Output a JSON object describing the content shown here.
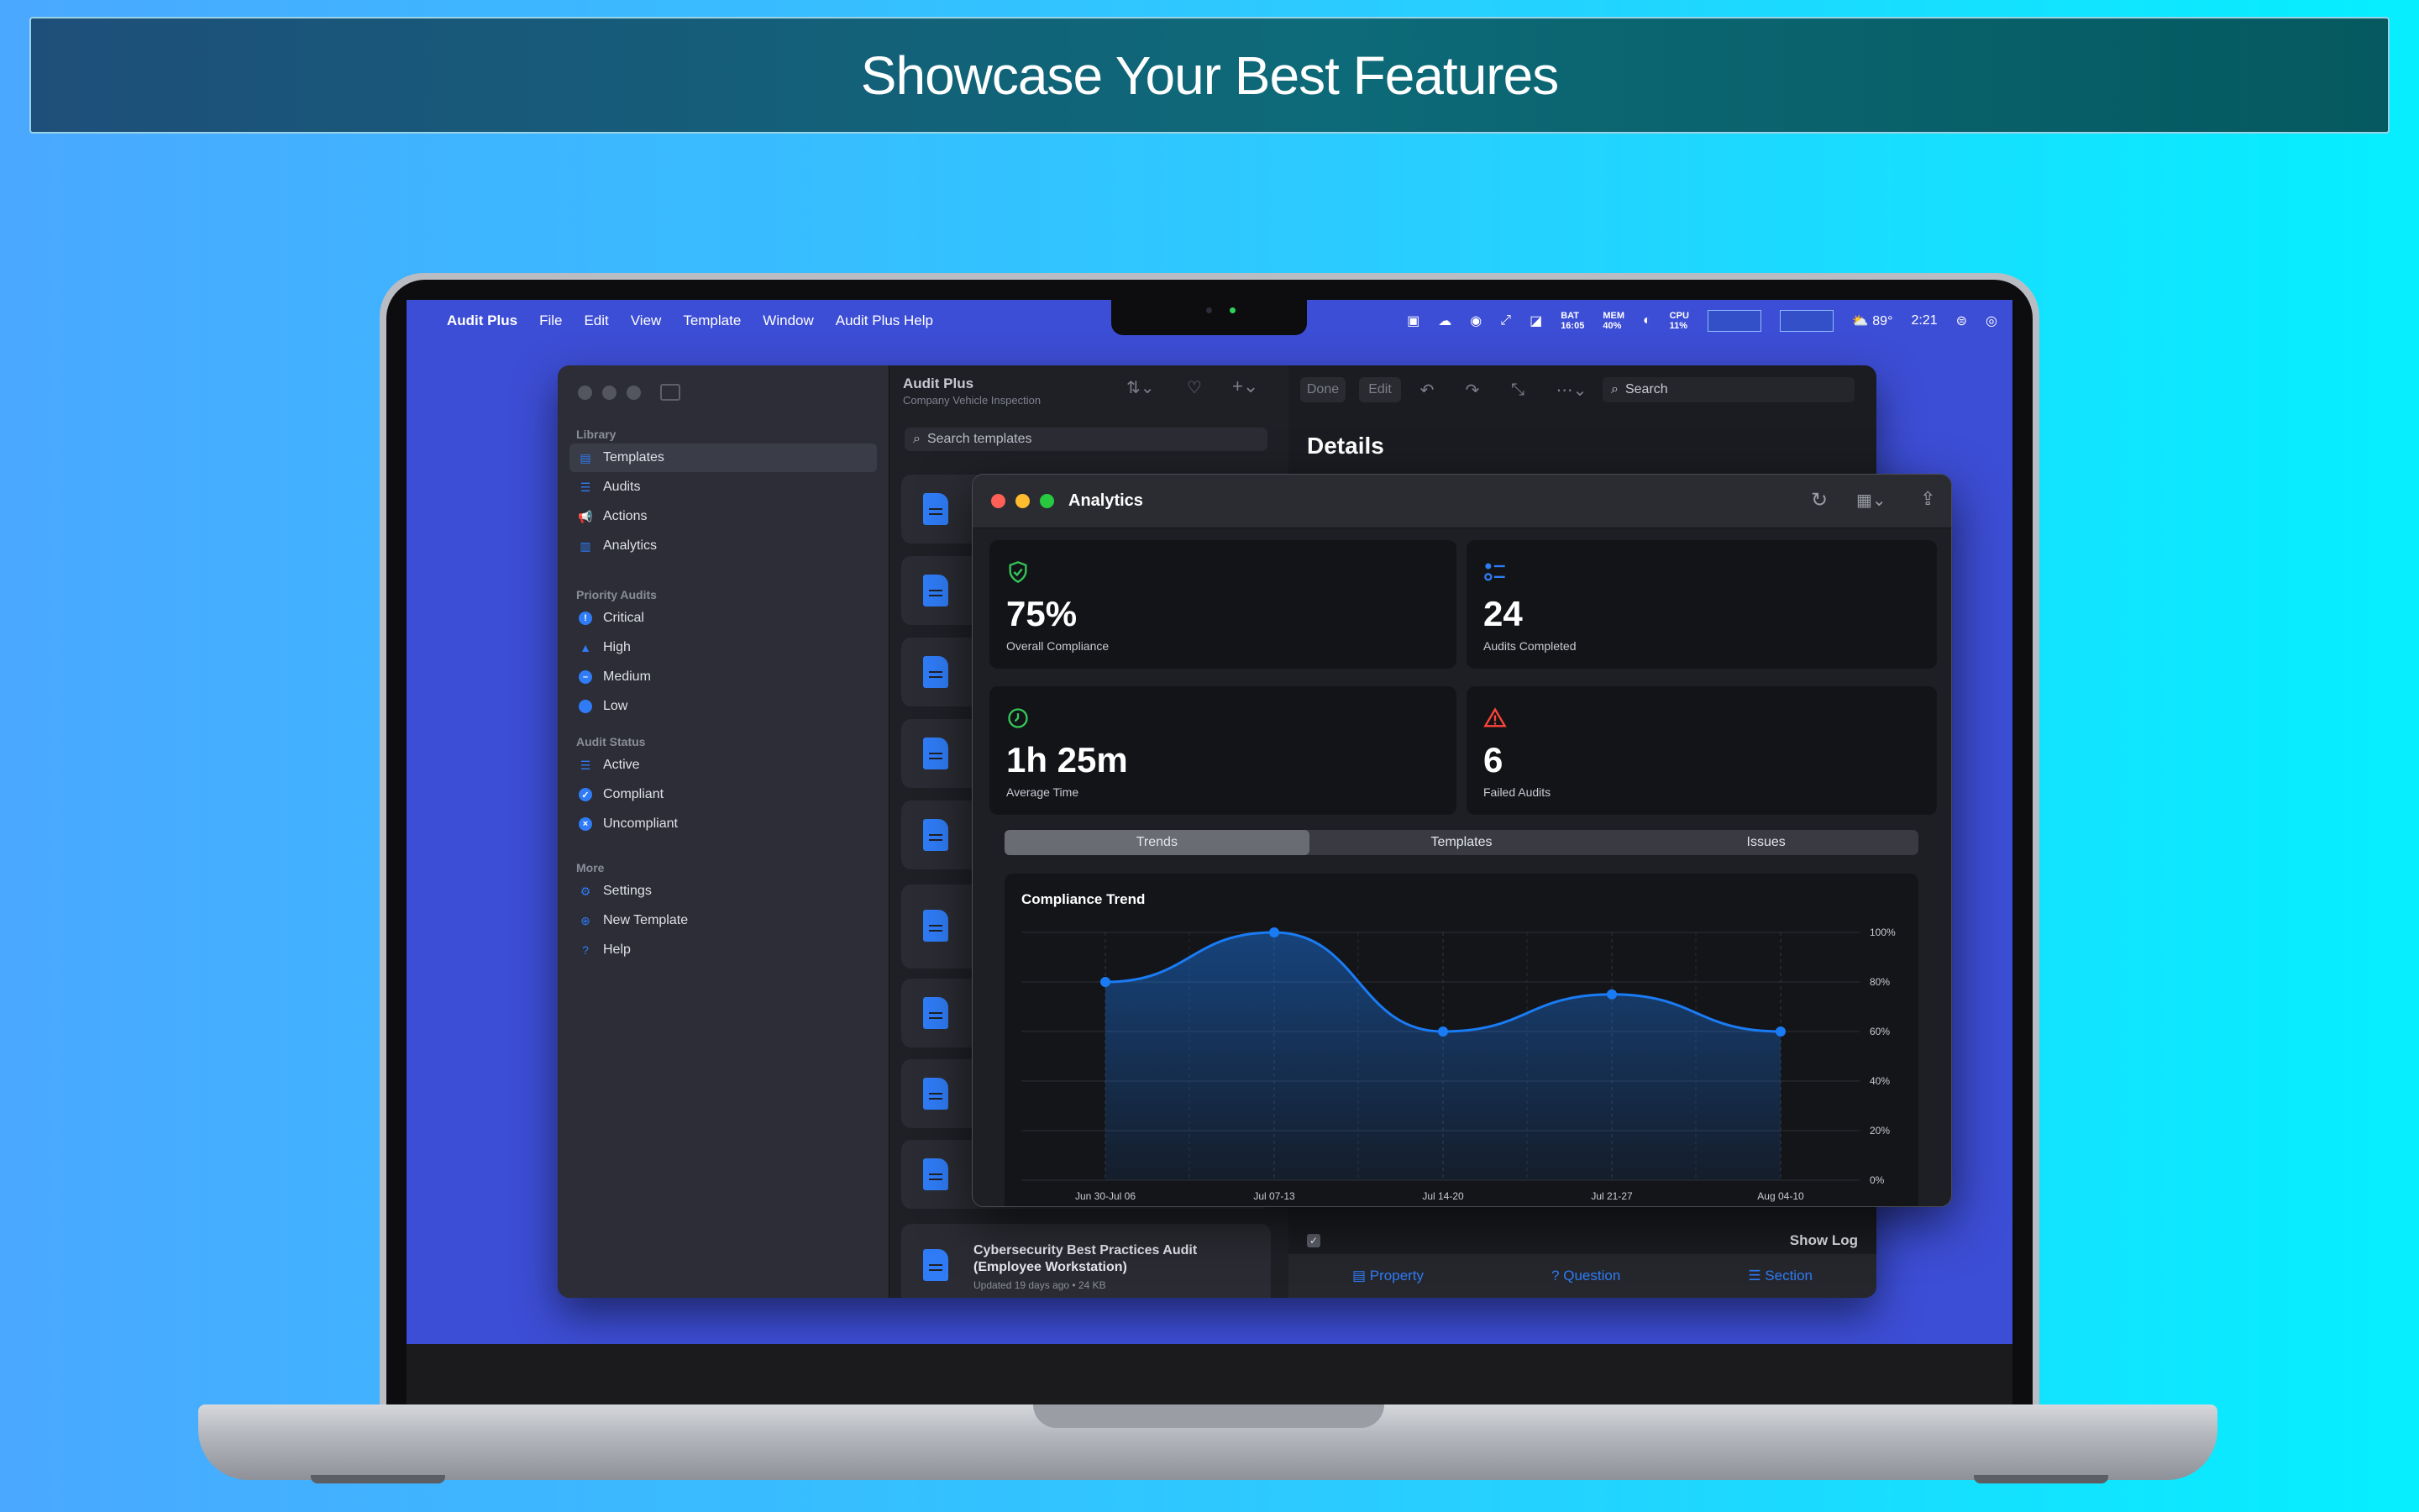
{
  "banner": {
    "title": "Showcase Your Best Features"
  },
  "menubar": {
    "app": "Audit Plus",
    "items": [
      "File",
      "Edit",
      "View",
      "Template",
      "Window",
      "Audit Plus Help"
    ],
    "bat_label": "BAT",
    "bat_value": "16:05",
    "mem_label": "MEM",
    "mem_value": "40%",
    "cpu_label": "CPU",
    "cpu_value": "11%",
    "weather": "89°",
    "time": "2:21"
  },
  "sidebar": {
    "library_title": "Library",
    "library": [
      {
        "label": "Templates",
        "icon": "doc-icon"
      },
      {
        "label": "Audits",
        "icon": "checklist-icon"
      },
      {
        "label": "Actions",
        "icon": "megaphone-icon"
      },
      {
        "label": "Analytics",
        "icon": "bar-chart-icon"
      }
    ],
    "priority_title": "Priority Audits",
    "priority": [
      {
        "label": "Critical",
        "icon": "exclamation-circle-icon"
      },
      {
        "label": "High",
        "icon": "warning-triangle-icon"
      },
      {
        "label": "Medium",
        "icon": "minus-circle-icon"
      },
      {
        "label": "Low",
        "icon": "circle-icon"
      }
    ],
    "status_title": "Audit Status",
    "status": [
      {
        "label": "Active",
        "icon": "checklist-icon"
      },
      {
        "label": "Compliant",
        "icon": "check-circle-icon"
      },
      {
        "label": "Uncompliant",
        "icon": "x-circle-icon"
      }
    ],
    "more_title": "More",
    "more": [
      {
        "label": "Settings",
        "icon": "gear-icon"
      },
      {
        "label": "New Template",
        "icon": "plus-circle-icon"
      },
      {
        "label": "Help",
        "icon": "question-circle-icon"
      }
    ]
  },
  "list": {
    "title": "Audit Plus",
    "subtitle": "Company Vehicle Inspection",
    "search_placeholder": "Search templates",
    "last_card_title": "Cybersecurity Best Practices Audit (Employee Workstation)",
    "last_card_meta": "Updated 19 days ago • 24 KB"
  },
  "detail": {
    "done": "Done",
    "edit": "Edit",
    "search": "Search",
    "title": "Details",
    "show_log": "Show Log",
    "bottom": [
      "Property",
      "Question",
      "Section"
    ]
  },
  "analytics": {
    "title": "Analytics",
    "tiles": [
      {
        "value": "75%",
        "label": "Overall Compliance",
        "icon": "shield-check-icon",
        "color": "#34c759"
      },
      {
        "value": "24",
        "label": "Audits Completed",
        "icon": "checklist-icon",
        "color": "#2f7cf6"
      },
      {
        "value": "1h 25m",
        "label": "Average Time",
        "icon": "clock-icon",
        "color": "#34c759"
      },
      {
        "value": "6",
        "label": "Failed Audits",
        "icon": "warning-triangle-icon",
        "color": "#ff453a"
      }
    ],
    "tabs": [
      "Trends",
      "Templates",
      "Issues"
    ],
    "active_tab": "Trends"
  },
  "chart_data": {
    "type": "area",
    "title": "Compliance Trend",
    "categories": [
      "Jun 30-Jul 06",
      "Jul 07-13",
      "Jul 14-20",
      "Jul 21-27",
      "Aug 04-10"
    ],
    "values": [
      80,
      100,
      60,
      75,
      60
    ],
    "ylim": [
      0,
      100
    ],
    "yticks": [
      "0%",
      "20%",
      "40%",
      "60%",
      "80%",
      "100%"
    ],
    "grid": true,
    "color": "#1a7cf5"
  }
}
